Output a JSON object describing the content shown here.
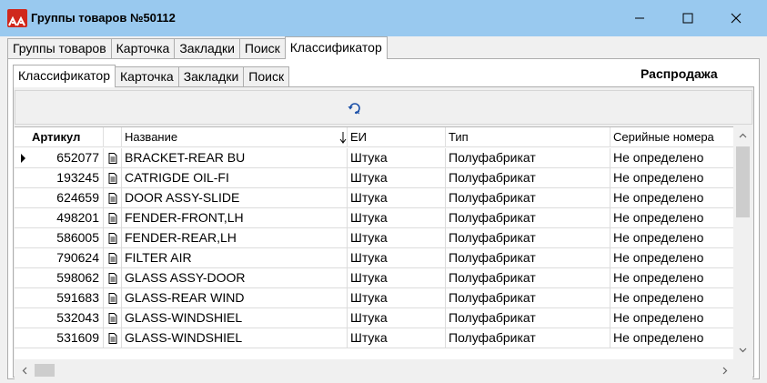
{
  "window": {
    "title": "Группы товаров №50112",
    "icon": "app-logo-icon",
    "title_bar_color": "#99c9ef"
  },
  "outer_tabs": [
    {
      "label": "Группы товаров",
      "active": false
    },
    {
      "label": "Карточка",
      "active": false
    },
    {
      "label": "Закладки",
      "active": false
    },
    {
      "label": "Поиск",
      "active": false
    },
    {
      "label": "Классификатор",
      "active": true
    }
  ],
  "inner_tabs": [
    {
      "label": "Классификатор",
      "active": true
    },
    {
      "label": "Карточка",
      "active": false
    },
    {
      "label": "Закладки",
      "active": false
    },
    {
      "label": "Поиск",
      "active": false
    }
  ],
  "sale_label": "Распродажа",
  "toolbar": {
    "refresh_icon": "refresh-icon"
  },
  "grid": {
    "columns": {
      "article": "Артикул",
      "name": "Название",
      "unit": "ЕИ",
      "type": "Тип",
      "serial": "Серийные номера"
    },
    "rows": [
      {
        "article": "652077",
        "name": "BRACKET-REAR BU",
        "unit": "Штука",
        "type": "Полуфабрикат",
        "serial": "Не определено",
        "current": true
      },
      {
        "article": "193245",
        "name": "CATRIGDE OIL-FI",
        "unit": "Штука",
        "type": "Полуфабрикат",
        "serial": "Не определено",
        "current": false
      },
      {
        "article": "624659",
        "name": "DOOR ASSY-SLIDE",
        "unit": "Штука",
        "type": "Полуфабрикат",
        "serial": "Не определено",
        "current": false
      },
      {
        "article": "498201",
        "name": "FENDER-FRONT,LH",
        "unit": "Штука",
        "type": "Полуфабрикат",
        "serial": "Не определено",
        "current": false
      },
      {
        "article": "586005",
        "name": "FENDER-REAR,LH",
        "unit": "Штука",
        "type": "Полуфабрикат",
        "serial": "Не определено",
        "current": false
      },
      {
        "article": "790624",
        "name": "FILTER AIR",
        "unit": "Штука",
        "type": "Полуфабрикат",
        "serial": "Не определено",
        "current": false
      },
      {
        "article": "598062",
        "name": "GLASS ASSY-DOOR",
        "unit": "Штука",
        "type": "Полуфабрикат",
        "serial": "Не определено",
        "current": false
      },
      {
        "article": "591683",
        "name": "GLASS-REAR WIND",
        "unit": "Штука",
        "type": "Полуфабрикат",
        "serial": "Не определено",
        "current": false
      },
      {
        "article": "532043",
        "name": "GLASS-WINDSHIEL",
        "unit": "Штука",
        "type": "Полуфабрикат",
        "serial": "Не определено",
        "current": false
      },
      {
        "article": "531609",
        "name": "GLASS-WINDSHIEL",
        "unit": "Штука",
        "type": "Полуфабрикат",
        "serial": "Не определено",
        "current": false
      }
    ]
  }
}
